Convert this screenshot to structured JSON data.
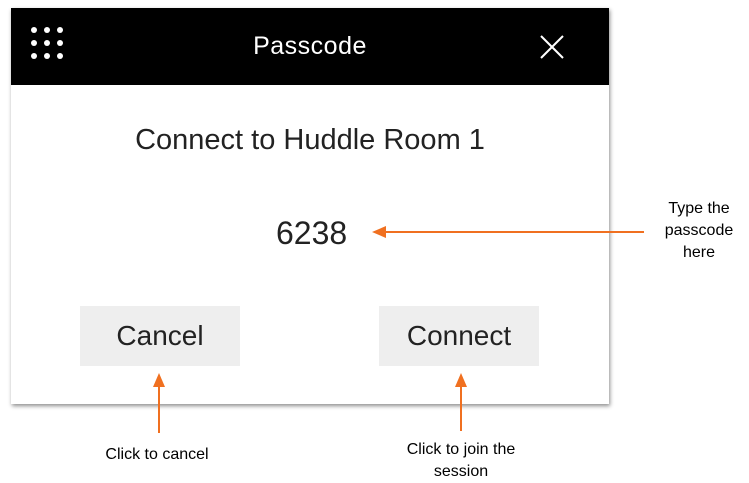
{
  "dialog": {
    "title": "Passcode",
    "heading": "Connect to Huddle Room 1",
    "passcode_value": "6238",
    "buttons": {
      "cancel_label": "Cancel",
      "connect_label": "Connect"
    },
    "icons": {
      "menu": "grid-menu-icon",
      "close": "close-icon"
    }
  },
  "annotations": {
    "passcode_note_line1": "Type the",
    "passcode_note_line2": "passcode",
    "passcode_note_line3": "here",
    "cancel_note": "Click to cancel",
    "connect_note_line1": "Click to join the",
    "connect_note_line2": "session"
  },
  "colors": {
    "titlebar": "#000000",
    "button_bg": "#eeeeee",
    "arrow": "#f07020"
  }
}
